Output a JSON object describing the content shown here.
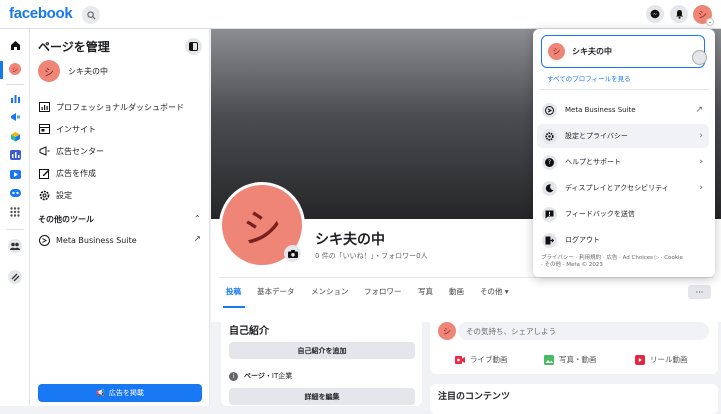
{
  "topbar": {
    "logo": "facebook",
    "avatar_initial": "シ"
  },
  "sidebar": {
    "title": "ページを管理",
    "page_name": "シキ夫の中",
    "page_initial": "シ",
    "items": [
      {
        "label": "プロフェッショナルダッシュボード",
        "icon": "dashboard-icon"
      },
      {
        "label": "インサイト",
        "icon": "insights-icon"
      },
      {
        "label": "広告センター",
        "icon": "megaphone-icon"
      },
      {
        "label": "広告を作成",
        "icon": "edit-icon"
      },
      {
        "label": "設定",
        "icon": "gear-icon"
      }
    ],
    "tools_header": "その他のツール",
    "tools": [
      {
        "label": "Meta Business Suite",
        "icon": "meta-business-icon"
      }
    ],
    "promo_button": "広告を掲載"
  },
  "profile": {
    "initial": "シ",
    "name": "シキ夫の中",
    "stats": "0 件の「いいね！」・フォロワー0人",
    "tabs": [
      "投稿",
      "基本データ",
      "メンション",
      "フォロワー",
      "写真",
      "動画",
      "その他"
    ],
    "more": "···"
  },
  "intro": {
    "title": "自己紹介",
    "add_button": "自己紹介を追加",
    "info_label": "ページ",
    "info_value": "・IT企業",
    "edit_button": "詳細を編集"
  },
  "composer": {
    "initial": "シ",
    "placeholder": "その気持ち、シェアしよう",
    "actions": [
      "ライブ動画",
      "写真・動画",
      "リール動画"
    ]
  },
  "featured": {
    "title": "注目のコンテンツ"
  },
  "dropdown": {
    "profile_name": "シキ夫の中",
    "profile_initial": "シ",
    "all_profiles": "すべてのプロフィールを見る",
    "items": [
      {
        "label": "Meta Business Suite",
        "icon": "meta-business-icon"
      },
      {
        "label": "設定とプライバシー",
        "icon": "gear-icon"
      },
      {
        "label": "ヘルプとサポート",
        "icon": "help-icon"
      },
      {
        "label": "ディスプレイとアクセシビリティ",
        "icon": "moon-icon"
      },
      {
        "label": "フィードバックを送信",
        "icon": "feedback-icon"
      },
      {
        "label": "ログアウト",
        "icon": "logout-icon"
      }
    ],
    "footer_line1": "プライバシー · 利用規約 · 広告 · Ad Choices ▷ · Cookie",
    "footer_line2": "· その他 · Meta © 2023"
  },
  "colors": {
    "brand": "#1877f2",
    "avatar": "#ef8577",
    "page_bg": "#f0f2f5"
  }
}
